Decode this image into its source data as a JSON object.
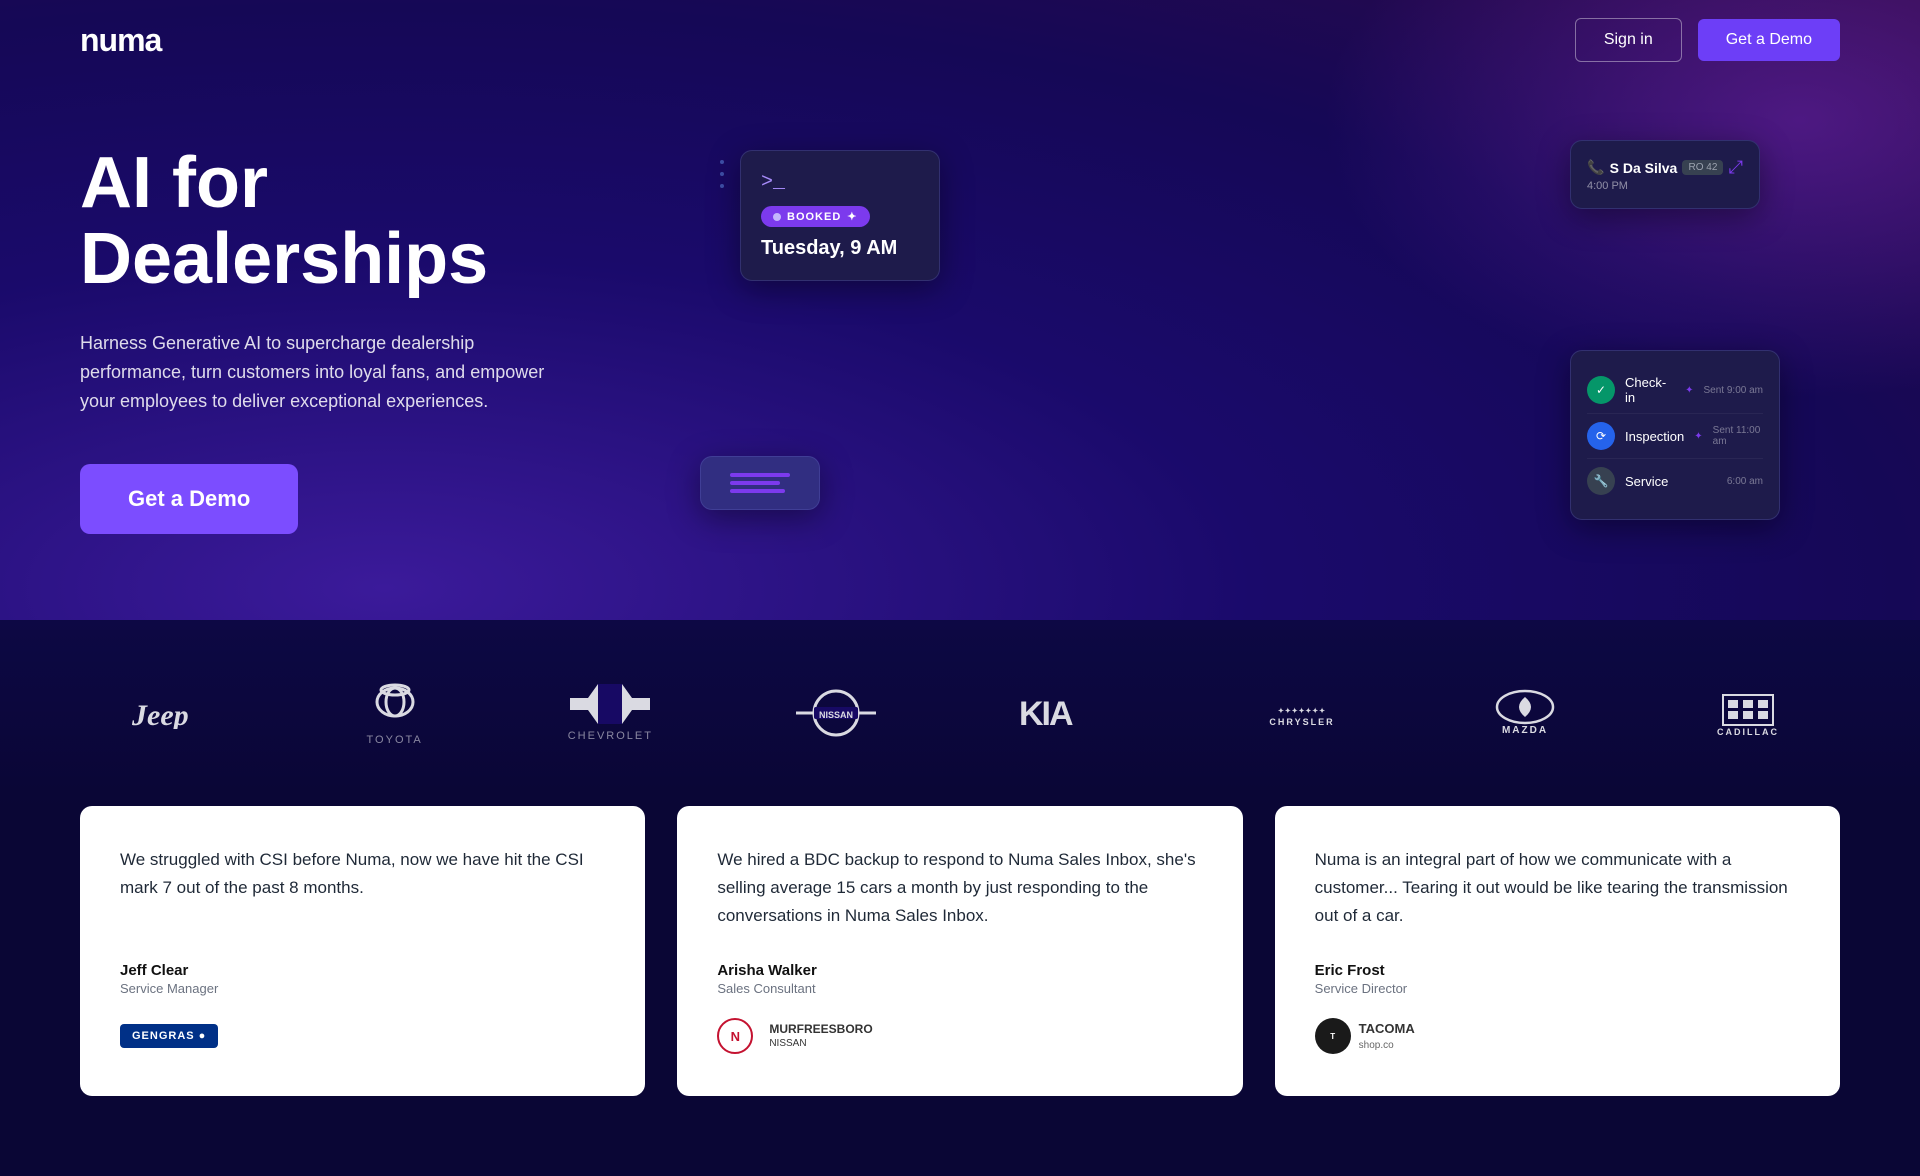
{
  "brand": {
    "name": "numa",
    "logo_text": "numa"
  },
  "nav": {
    "signin_label": "Sign in",
    "get_demo_label": "Get a Demo"
  },
  "hero": {
    "title": "AI for Dealerships",
    "subtitle": "Harness Generative AI to supercharge dealership performance, turn customers into loyal fans, and empower your employees to deliver exceptional experiences.",
    "cta_label": "Get a Demo"
  },
  "mock_ui": {
    "terminal_prompt": ">_",
    "booked_badge": "BOOKED",
    "appointment_time": "Tuesday, 9 AM",
    "contact_name": "S Da Silva",
    "contact_time": "4:00 PM",
    "contact_badge": "RO 42",
    "timeline": [
      {
        "label": "Check-in",
        "time": "Sent 9:00 am",
        "color": "green"
      },
      {
        "label": "Inspection",
        "time": "Sent 11:00 am",
        "color": "blue"
      },
      {
        "label": "Service",
        "time": "6:00 am",
        "color": "gray"
      }
    ]
  },
  "brands": [
    {
      "name": "Jeep",
      "style": "jeep"
    },
    {
      "name": "TOYOTA",
      "style": "toyota"
    },
    {
      "name": "CHEVROLET",
      "style": "chevrolet"
    },
    {
      "name": "NISSAN",
      "style": "nissan"
    },
    {
      "name": "KIA",
      "style": "kia"
    },
    {
      "name": "CHRYSLER",
      "style": "chrysler"
    },
    {
      "name": "MAZDA",
      "style": "mazda"
    },
    {
      "name": "CADILLAC",
      "style": "cadillac"
    }
  ],
  "testimonials": [
    {
      "text": "We struggled with CSI before Numa, now we have hit the CSI mark 7 out of the past 8 months.",
      "author": "Jeff Clear",
      "role": "Service Manager",
      "logo_type": "gengras"
    },
    {
      "text": "We hired a BDC backup to respond to Numa Sales Inbox, she's selling average 15 cars a month by just responding to the conversations in Numa Sales Inbox.",
      "author": "Arisha Walker",
      "role": "Sales Consultant",
      "logo_type": "nissan"
    },
    {
      "text": "Numa is an integral part of how we communicate with a customer... Tearing it out would be like tearing the transmission out of a car.",
      "author": "Eric Frost",
      "role": "Service Director",
      "logo_type": "tacoma"
    }
  ]
}
